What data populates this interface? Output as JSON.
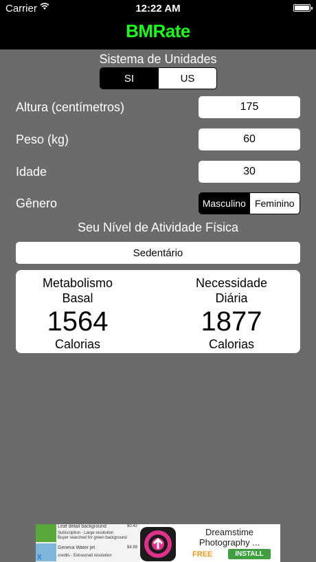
{
  "status_bar": {
    "carrier": "Carrier",
    "time": "12:22 AM",
    "battery_level": 1.0
  },
  "app": {
    "title": "BMRate",
    "title_color": "#19ff19"
  },
  "units": {
    "label": "Sistema de Unidades",
    "options": [
      "SI",
      "US"
    ],
    "selected": "SI"
  },
  "fields": {
    "height": {
      "label": "Altura (centímetros)",
      "value": "175"
    },
    "weight": {
      "label": "Peso (kg)",
      "value": "60"
    },
    "age": {
      "label": "Idade",
      "value": "30"
    }
  },
  "gender": {
    "label": "Gênero",
    "options": [
      "Masculino",
      "Feminino"
    ],
    "selected": "Masculino"
  },
  "activity": {
    "label": "Seu Nível de Atividade Física",
    "value": "Sedentário"
  },
  "results": {
    "basal": {
      "line1": "Metabolismo",
      "line2": "Basal",
      "value": "1564",
      "unit": "Calorias"
    },
    "daily": {
      "line1": "Necessidade",
      "line2": "Diária",
      "value": "1877",
      "unit": "Calorias"
    }
  },
  "ad": {
    "item1": "Leaf detail background",
    "item1_sub1": "Subscription - Large resolution",
    "item1_sub2": "Buyer searched for green background",
    "item1_price": "$0.42",
    "item2": "Geneva Water jet",
    "item2_sub": "credits - Extrasmall resolution",
    "item2_price": "$4.89",
    "close": "X",
    "title": "Dreamstime Photography ...",
    "price": "FREE",
    "install": "INSTALL"
  }
}
